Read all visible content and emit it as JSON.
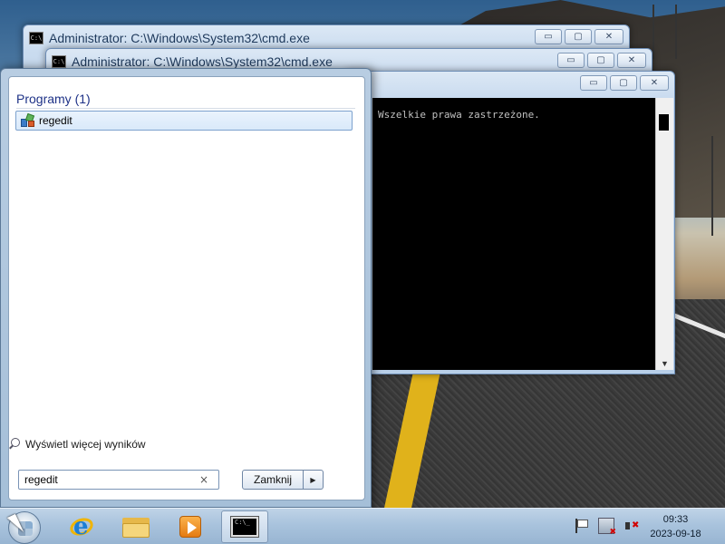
{
  "windows": [
    {
      "title": "Administrator: C:\\Windows\\System32\\cmd.exe",
      "icon": "cmd-icon"
    },
    {
      "title": "Administrator: C:\\Windows\\System32\\cmd.exe",
      "icon": "cmd-icon"
    },
    {
      "title": "",
      "console_text": "Wszelkie prawa zastrzeżone."
    }
  ],
  "caption_buttons": {
    "minimize": "▭",
    "maximize": "▢",
    "close": "✕"
  },
  "start_menu": {
    "section_title": "Programy (1)",
    "results": [
      {
        "label": "regedit",
        "icon": "regedit-icon"
      }
    ],
    "see_more": "Wyświetl więcej wyników",
    "search_value": "regedit",
    "clear_icon": "×",
    "shutdown_label": "Zamknij",
    "shutdown_arrow": "▶"
  },
  "taskbar": {
    "pinned": [
      "internet-explorer-icon",
      "windows-explorer-icon",
      "media-player-icon",
      "cmd-icon"
    ],
    "cmd_icon_text": "C:\\_",
    "tray_icons": [
      "action-center-flag-icon",
      "network-icon",
      "volume-muted-icon"
    ],
    "time": "09:33",
    "date": "2023-09-18"
  },
  "colors": {
    "accent": "#1e3287",
    "selection_border": "#7da2ce",
    "console_bg": "#000000"
  }
}
